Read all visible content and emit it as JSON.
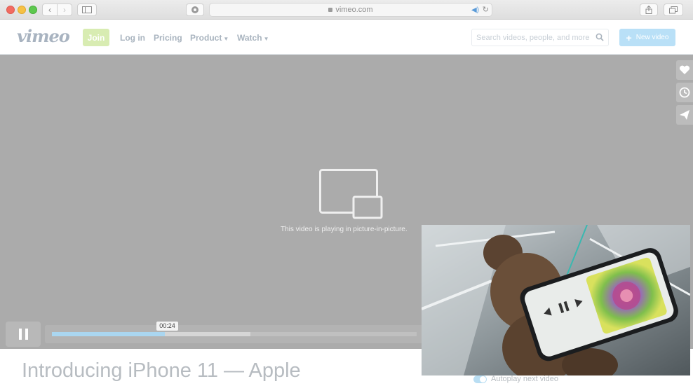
{
  "browser": {
    "url": "vimeo.com",
    "traffic_colors": [
      "#f26b61",
      "#f6c144",
      "#5dc84e"
    ]
  },
  "header": {
    "logo": "vimeo",
    "join_label": "Join",
    "nav": {
      "login": "Log in",
      "pricing": "Pricing",
      "product": "Product",
      "watch": "Watch"
    },
    "search_placeholder": "Search videos, people, and more",
    "new_video_label": "New video"
  },
  "player": {
    "pip_message": "This video is playing in picture-in-picture.",
    "current_time": "00:24",
    "played_fraction": 0.31,
    "side_actions": [
      "heart-icon",
      "clock-icon",
      "paper-plane-icon"
    ]
  },
  "video": {
    "title": "Introducing iPhone 11 — Apple",
    "autoplay_label": "Autoplay next video",
    "autoplay_on": true
  },
  "colors": {
    "accent": "#b9e0f7",
    "join": "#d8ecb2",
    "player_bg": "#ababab"
  }
}
